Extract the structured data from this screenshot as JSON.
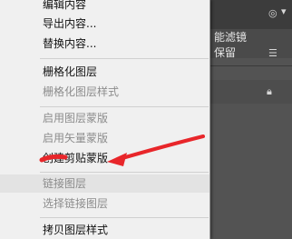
{
  "background_panel": {
    "row1_label": "能滤镜",
    "row2_label": "保留"
  },
  "menu": {
    "items": [
      {
        "label": "编辑内容",
        "enabled": true
      },
      {
        "label": "导出内容...",
        "enabled": true
      },
      {
        "label": "替换内容...",
        "enabled": true
      },
      {
        "label": "栅格化图层",
        "enabled": true
      },
      {
        "label": "栅格化图层样式",
        "enabled": false
      },
      {
        "label": "启用图层蒙版",
        "enabled": false
      },
      {
        "label": "启用矢量蒙版",
        "enabled": false
      },
      {
        "label": "创建剪贴蒙版",
        "enabled": true
      },
      {
        "label": "链接图层",
        "enabled": false
      },
      {
        "label": "选择链接图层",
        "enabled": false
      },
      {
        "label": "拷贝图层样式",
        "enabled": true
      }
    ]
  },
  "annotation": {
    "arrow_color": "#e8262a"
  }
}
